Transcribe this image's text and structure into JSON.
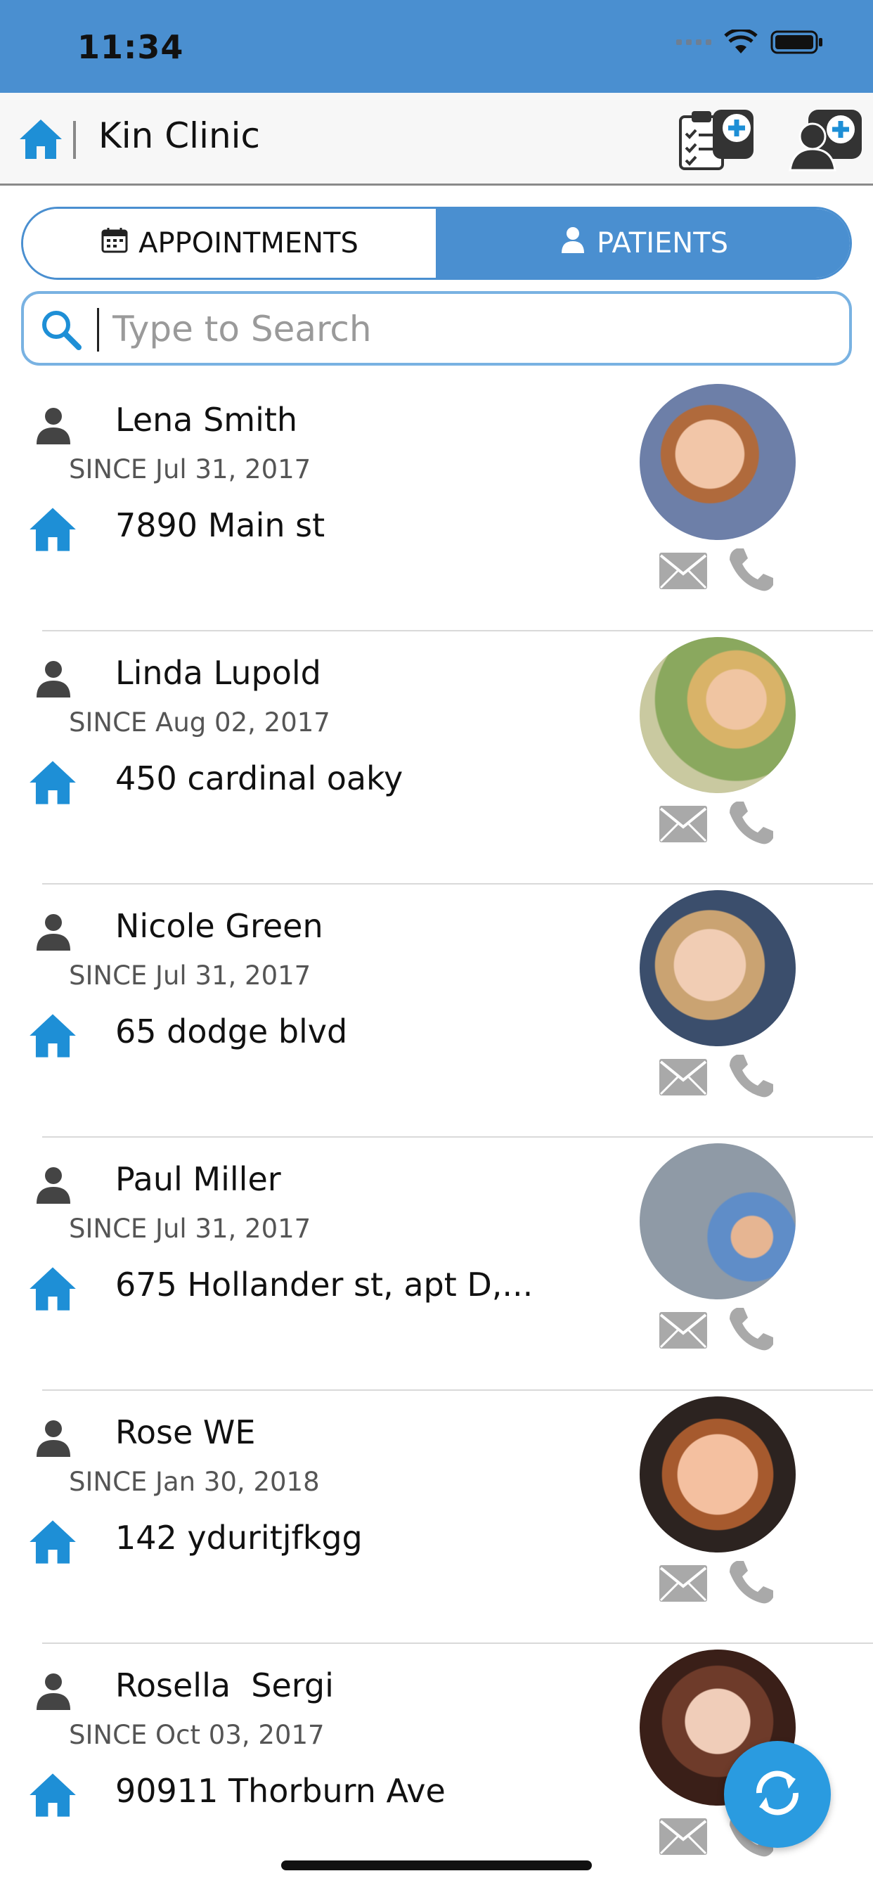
{
  "status_bar": {
    "time": "11:34"
  },
  "header": {
    "title": "Kin Clinic"
  },
  "segments": {
    "appointments_label": "APPOINTMENTS",
    "patients_label": "PATIENTS",
    "selected": "PATIENTS"
  },
  "search": {
    "placeholder": "Type to Search",
    "value": ""
  },
  "patients": [
    {
      "name": "Lena Smith",
      "since": "SINCE Jul 31, 2017",
      "address": "7890 Main st"
    },
    {
      "name": "Linda Lupold",
      "since": "SINCE Aug 02, 2017",
      "address": "450 cardinal oaky"
    },
    {
      "name": "Nicole Green",
      "since": "SINCE Jul 31, 2017",
      "address": "65 dodge blvd"
    },
    {
      "name": "Paul Miller",
      "since": "SINCE Jul 31, 2017",
      "address": "675 Hollander st, apt D,..."
    },
    {
      "name": "Rose WE",
      "since": "SINCE Jan 30, 2018",
      "address": "142 yduritjfkgg"
    },
    {
      "name": "Rosella  Sergi",
      "since": "SINCE Oct 03, 2017",
      "address": "90911 Thorburn Ave"
    }
  ],
  "icons": {
    "home": "home-icon",
    "add_appointment": "clipboard-add-icon",
    "add_patient": "add-patient-icon",
    "calendar": "calendar-icon",
    "person": "person-icon",
    "search": "search-icon",
    "mail": "mail-icon",
    "phone": "phone-icon",
    "refresh": "refresh-icon"
  },
  "colors": {
    "accent": "#4a8fd0",
    "house_icon": "#1e8fd6",
    "fab": "#2a9be0",
    "action_icons": "#a9a9a9",
    "person_icon": "#444444"
  }
}
